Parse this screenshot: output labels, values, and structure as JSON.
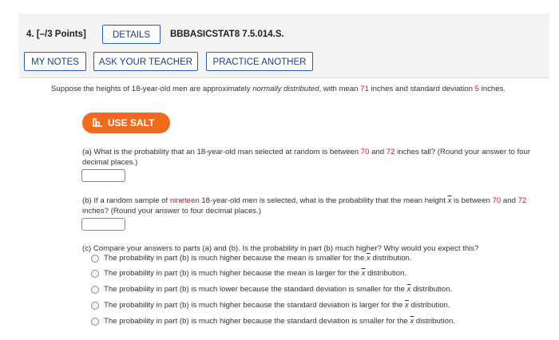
{
  "header": {
    "question_number": "4.",
    "points": "[–/3 Points]",
    "details_label": "DETAILS",
    "problem_code": "BBBASICSTAT8 7.5.014.S.",
    "my_notes_label": "MY NOTES",
    "ask_teacher_label": "ASK YOUR TEACHER",
    "practice_label": "PRACTICE ANOTHER"
  },
  "intro": {
    "part1": "Suppose the heights of 18-year-old men are approximately ",
    "italic": "normally distributed",
    "part2": ", with mean ",
    "mean": "71",
    "part3": " inches and standard deviation ",
    "sd": "5",
    "part4": " inches."
  },
  "salt": {
    "label": "USE SALT"
  },
  "part_a": {
    "p1": "(a) What is the probability that an 18-year-old man selected at random is between ",
    "v1": "70",
    "p2": " and ",
    "v2": "72",
    "p3": " inches tall? (Round your answer to four decimal places.)",
    "value": ""
  },
  "part_b": {
    "p1": "(b) If a random sample of ",
    "n": "nineteen",
    "p2": " 18-year-old men is selected, what is the probability that the mean height ",
    "xbar": "x",
    "p3": " is between ",
    "v1": "70",
    "p4": " and ",
    "v2": "72",
    "p5": " inches? (Round your answer to four decimal places.)",
    "value": ""
  },
  "part_c": {
    "prompt": "(c) Compare your answers to parts (a) and (b). Is the probability in part (b) much higher? Why would you expect this?",
    "xbar": "x",
    "options": [
      {
        "text": "The probability in part (b) is much higher because the mean is smaller for the ",
        "suffix": " distribution."
      },
      {
        "text": "The probability in part (b) is much higher because the mean is larger for the ",
        "suffix": " distribution."
      },
      {
        "text": "The probability in part (b) is much lower because the standard deviation is smaller for the ",
        "suffix": " distribution."
      },
      {
        "text": "The probability in part (b) is much higher because the standard deviation is larger for the ",
        "suffix": " distribution."
      },
      {
        "text": "The probability in part (b) is much higher because the standard deviation is smaller for the ",
        "suffix": " distribution."
      }
    ]
  }
}
